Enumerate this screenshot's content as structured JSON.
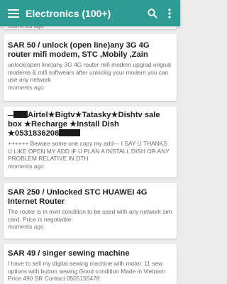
{
  "header": {
    "title": "Electronics (100+)",
    "background_color": "#2f9c93"
  },
  "listings": [
    {
      "title": "",
      "description": "",
      "time": "moments ago"
    },
    {
      "title": "SAR 50 / unlock (open line)any 3G 4G router mifi modem, STC ,Mobily ,Zain",
      "description": "unlock(open line)any 3G 4G router mifi modem upgrad orignal modems & mifi softwears after unlockig your modem you can use any network",
      "time": "moments ago"
    },
    {
      "title_parts": {
        "part1": "Airtel",
        "star": "★",
        "part2": "Bigtv",
        "part3": "Tatasky",
        "part4": "Dishtv sale box",
        "part5": "Recharge",
        "part6": "Install Dish",
        "part7": "0531836208"
      },
      "description": "++++++ Beware some one copy my add--- I SAY U THANKS U LIKE OPEN MY ADD IF U PLAN A INSTALL DISH OR ANY PROBLEM RELATIVE IN DTH",
      "time": "moments ago"
    },
    {
      "title": "SAR 250 / Unlocked STC HUAWEI 4G Internet Router",
      "description": "The router is in mint condition to be used with any network sim card. Price is negotiable.",
      "time": "moments ago"
    },
    {
      "title": "SAR 49 / singer sewing machine",
      "description": "I have to sell my digital sewing machine with motor. 11 sew options with button sewing Good condition Made in Vietnam Price 490 SR Contact 0505155478",
      "time": ""
    }
  ]
}
